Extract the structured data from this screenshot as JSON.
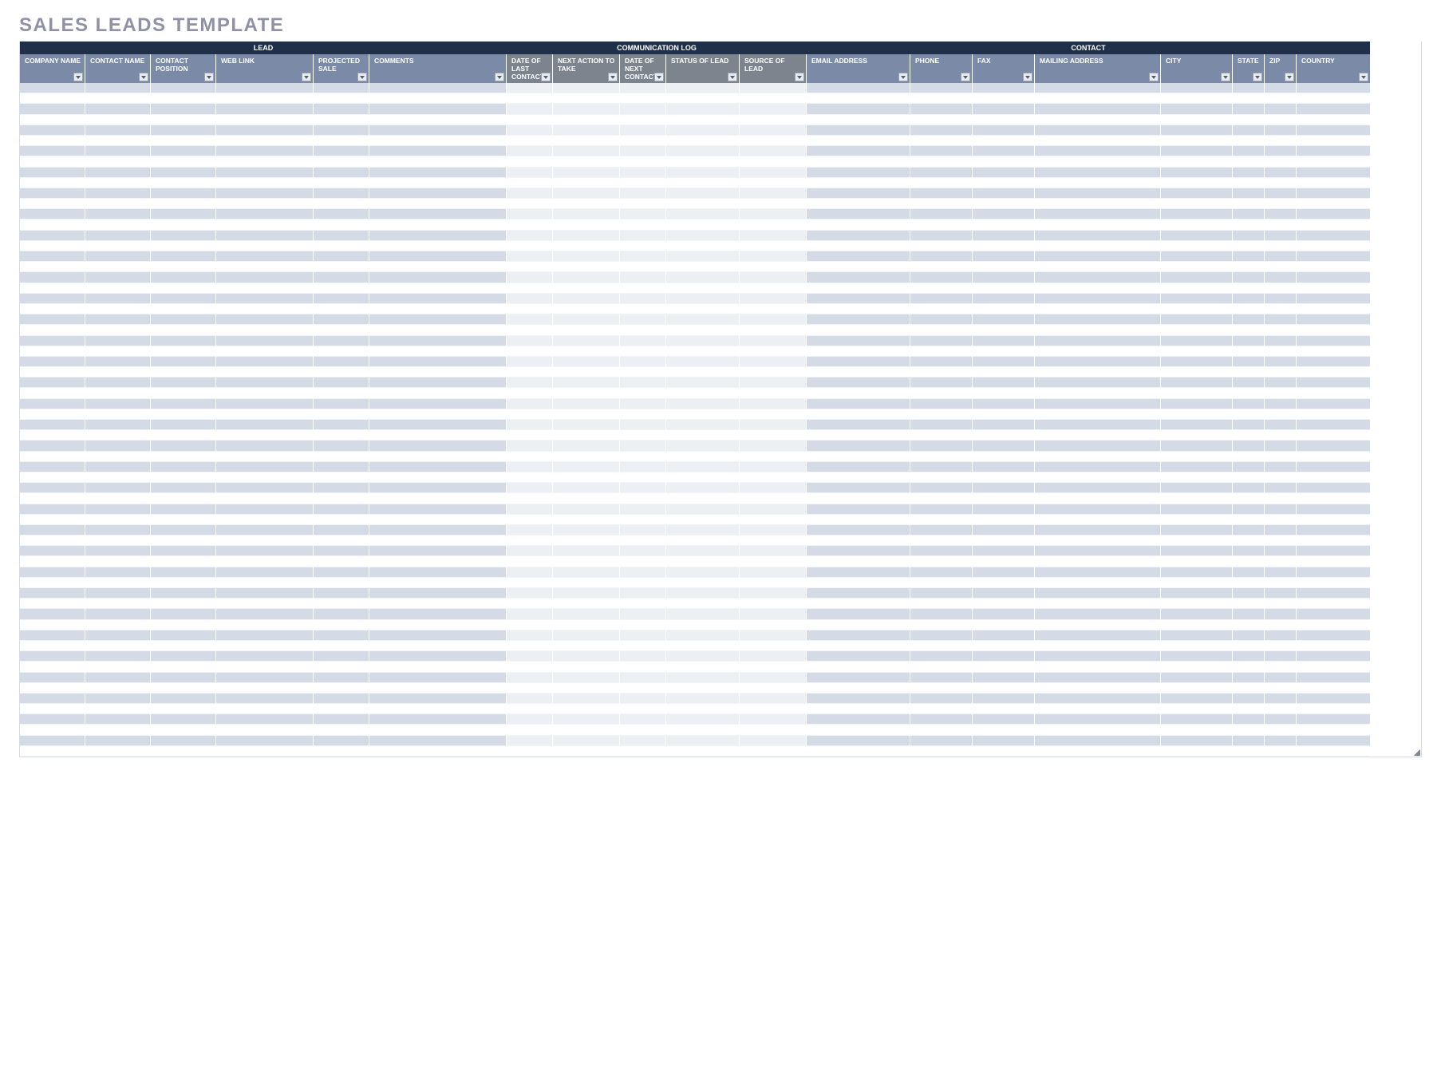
{
  "title": "SALES LEADS TEMPLATE",
  "groups": [
    {
      "label": "LEAD",
      "class": "g-lead"
    },
    {
      "label": "COMMUNICATION LOG",
      "class": "g-comm"
    },
    {
      "label": "CONTACT",
      "class": "g-contact"
    }
  ],
  "columns": [
    {
      "label": "COMPANY NAME",
      "zone": "lead",
      "w": "c0"
    },
    {
      "label": "CONTACT NAME",
      "zone": "lead",
      "w": "c1"
    },
    {
      "label": "CONTACT POSITION",
      "zone": "lead",
      "w": "c2"
    },
    {
      "label": "WEB LINK",
      "zone": "lead",
      "w": "c3"
    },
    {
      "label": "PROJECTED SALE",
      "zone": "lead",
      "w": "c4"
    },
    {
      "label": "COMMENTS",
      "zone": "lead",
      "w": "c5"
    },
    {
      "label": "DATE OF LAST CONTACT",
      "zone": "comm",
      "w": "c6"
    },
    {
      "label": "NEXT ACTION TO TAKE",
      "zone": "comm",
      "w": "c7"
    },
    {
      "label": "DATE OF NEXT CONTACT",
      "zone": "comm",
      "w": "c8"
    },
    {
      "label": "STATUS OF LEAD",
      "zone": "comm",
      "w": "c9"
    },
    {
      "label": "SOURCE OF LEAD",
      "zone": "comm",
      "w": "c10"
    },
    {
      "label": "EMAIL ADDRESS",
      "zone": "contact",
      "w": "c11"
    },
    {
      "label": "PHONE",
      "zone": "contact",
      "w": "c12"
    },
    {
      "label": "FAX",
      "zone": "contact",
      "w": "c13"
    },
    {
      "label": "MAILING ADDRESS",
      "zone": "contact",
      "w": "c14"
    },
    {
      "label": "CITY",
      "zone": "contact",
      "w": "c15"
    },
    {
      "label": "STATE",
      "zone": "contact",
      "w": "c16"
    },
    {
      "label": "ZIP",
      "zone": "contact",
      "w": "c17"
    },
    {
      "label": "COUNTRY",
      "zone": "contact",
      "w": "c18"
    }
  ],
  "row_count": 64,
  "rows": []
}
